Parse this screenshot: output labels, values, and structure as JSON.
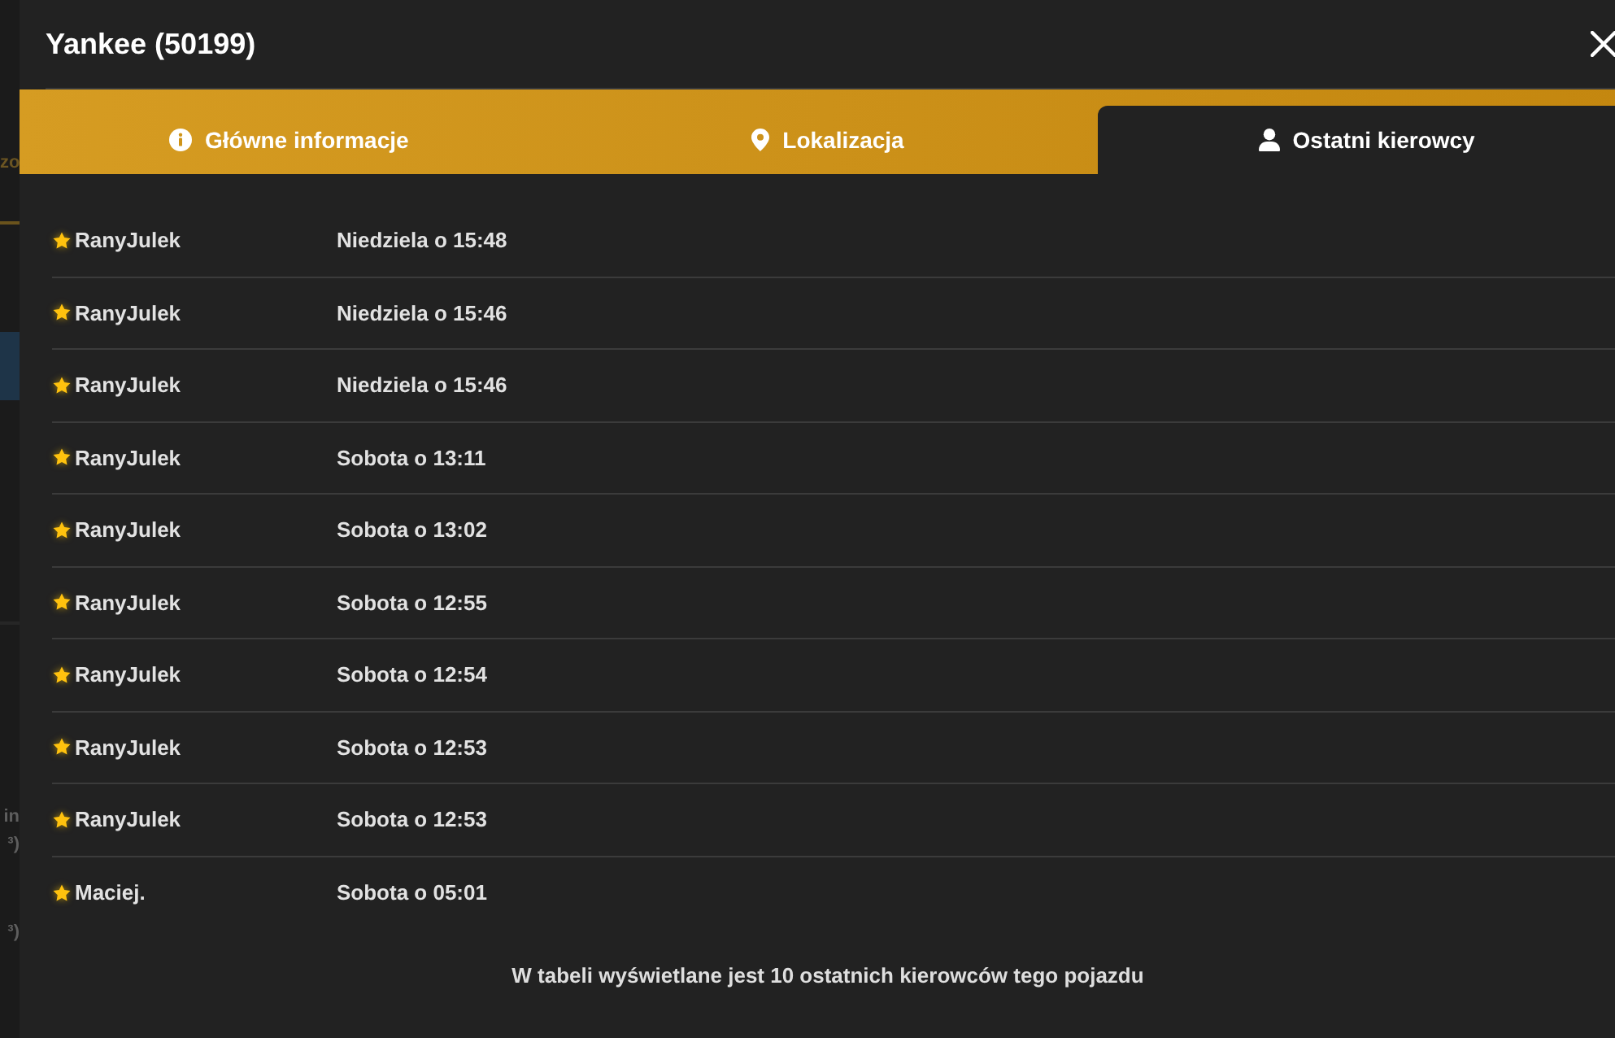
{
  "background_page": {
    "fragments": [
      "zo",
      "in",
      "³)",
      "³)"
    ]
  },
  "modal": {
    "title": "Yankee (50199)"
  },
  "tabs": [
    {
      "label": "Główne informacje",
      "selected": false
    },
    {
      "label": "Lokalizacja",
      "selected": false
    },
    {
      "label": "Ostatni kierowcy",
      "selected": true
    }
  ],
  "drivers_table": {
    "rows": [
      {
        "name": "RanyJulek",
        "time": "Niedziela o 15:48"
      },
      {
        "name": "RanyJulek",
        "time": "Niedziela o 15:46"
      },
      {
        "name": "RanyJulek",
        "time": "Niedziela o 15:46"
      },
      {
        "name": "RanyJulek",
        "time": "Sobota o 13:11"
      },
      {
        "name": "RanyJulek",
        "time": "Sobota o 13:02"
      },
      {
        "name": "RanyJulek",
        "time": "Sobota o 12:55"
      },
      {
        "name": "RanyJulek",
        "time": "Sobota o 12:54"
      },
      {
        "name": "RanyJulek",
        "time": "Sobota o 12:53"
      },
      {
        "name": "RanyJulek",
        "time": "Sobota o 12:53"
      },
      {
        "name": "Maciej.",
        "time": "Sobota o 05:01"
      }
    ]
  },
  "footer_note": "W tabeli wyświetlane jest 10 ostatnich kierowców tego pojazdu"
}
